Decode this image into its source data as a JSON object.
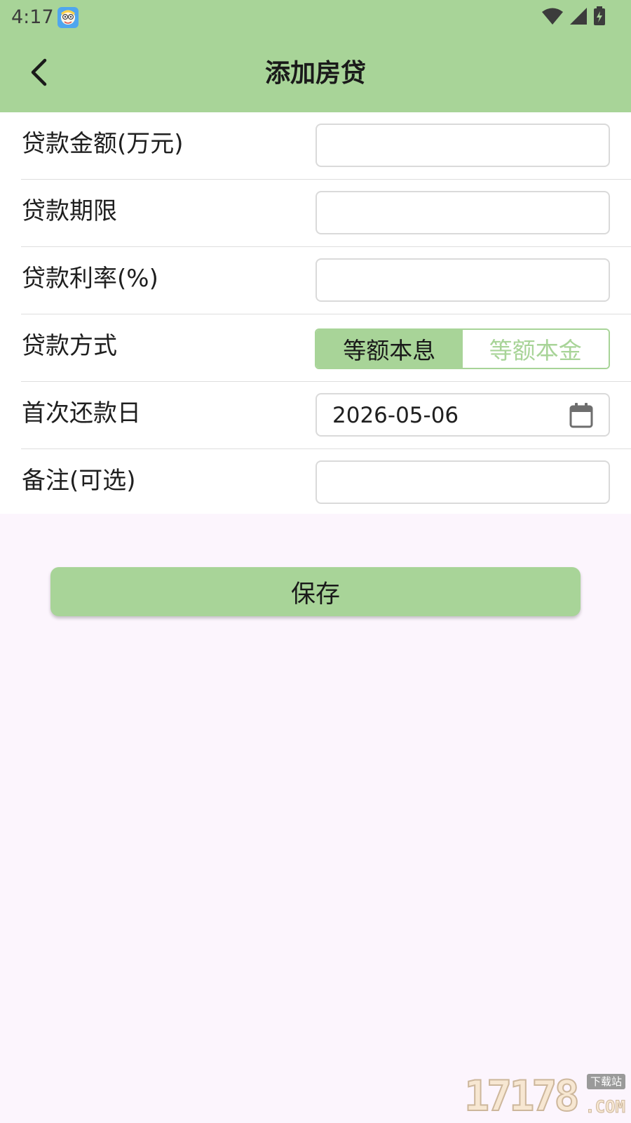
{
  "status_bar": {
    "time": "4:17",
    "icons": [
      "app-mascot-icon",
      "wifi-icon",
      "cellular-signal-icon",
      "battery-charging-icon"
    ]
  },
  "header": {
    "title": "添加房贷",
    "back_icon": "chevron-left-icon"
  },
  "form": {
    "loan_amount": {
      "label": "贷款金额(万元)",
      "value": "",
      "placeholder": ""
    },
    "loan_term": {
      "label": "贷款期限",
      "value": "",
      "placeholder": ""
    },
    "interest_rate": {
      "label": "贷款利率(%)",
      "value": "",
      "placeholder": ""
    },
    "repayment_method": {
      "label": "贷款方式",
      "options": [
        "等额本息",
        "等额本金"
      ],
      "selected": "等额本息"
    },
    "first_payment_date": {
      "label": "首次还款日",
      "value": "2026-05-06",
      "icon": "calendar-icon"
    },
    "notes": {
      "label": "备注(可选)",
      "value": "",
      "placeholder": ""
    }
  },
  "actions": {
    "save_label": "保存"
  },
  "watermark": {
    "digits": "17178",
    "badge": "下载站",
    "suffix": ".COM"
  },
  "colors": {
    "primary": "#a8d498",
    "page_background": "#fcf5fd",
    "card_background": "#ffffff",
    "divider": "#dedede",
    "input_border": "#dadada"
  }
}
